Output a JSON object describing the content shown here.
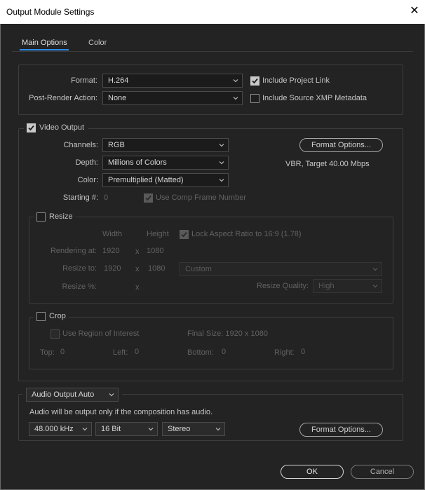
{
  "window": {
    "title": "Output Module Settings",
    "close_glyph": "✕"
  },
  "tabs": [
    {
      "label": "Main Options"
    },
    {
      "label": "Color"
    }
  ],
  "general": {
    "format_label": "Format:",
    "format_value": "H.264",
    "post_render_label": "Post-Render Action:",
    "post_render_value": "None",
    "include_project_link": "Include Project Link",
    "include_xmp": "Include Source XMP Metadata"
  },
  "video": {
    "heading": "Video Output",
    "channels_label": "Channels:",
    "channels_value": "RGB",
    "depth_label": "Depth:",
    "depth_value": "Millions of Colors",
    "color_label": "Color:",
    "color_value": "Premultiplied (Matted)",
    "starting_label": "Starting #:",
    "starting_value": "0",
    "use_comp_frame": "Use Comp Frame Number",
    "format_options": "Format Options...",
    "bitrate_info": "VBR, Target 40.00 Mbps"
  },
  "resize": {
    "heading": "Resize",
    "width_header": "Width",
    "height_header": "Height",
    "lock_aspect": "Lock Aspect Ratio to 16:9 (1.78)",
    "rendering_label": "Rendering at:",
    "rendering_w": "1920",
    "rendering_h": "1080",
    "resize_to_label": "Resize to:",
    "resize_to_w": "1920",
    "resize_to_h": "1080",
    "preset_value": "Custom",
    "resize_pct_label": "Resize %:",
    "times": "x",
    "quality_label": "Resize Quality:",
    "quality_value": "High"
  },
  "crop": {
    "heading": "Crop",
    "use_roi": "Use Region of Interest",
    "final_size": "Final Size: 1920 x 1080",
    "top_label": "Top:",
    "top_value": "0",
    "left_label": "Left:",
    "left_value": "0",
    "bottom_label": "Bottom:",
    "bottom_value": "0",
    "right_label": "Right:",
    "right_value": "0"
  },
  "audio": {
    "mode_value": "Audio Output Auto",
    "note": "Audio will be output only if the composition has audio.",
    "rate_value": "48.000 kHz",
    "bits_value": "16 Bit",
    "channels_value": "Stereo",
    "format_options": "Format Options..."
  },
  "footer": {
    "ok": "OK",
    "cancel": "Cancel"
  },
  "colors": {
    "accent": "#2d8ceb",
    "background": "#232323",
    "field": "#1b1b1b"
  },
  "icons": {
    "chevron": "chevron-down-icon",
    "check": "checkmark-icon",
    "close": "close-icon"
  }
}
